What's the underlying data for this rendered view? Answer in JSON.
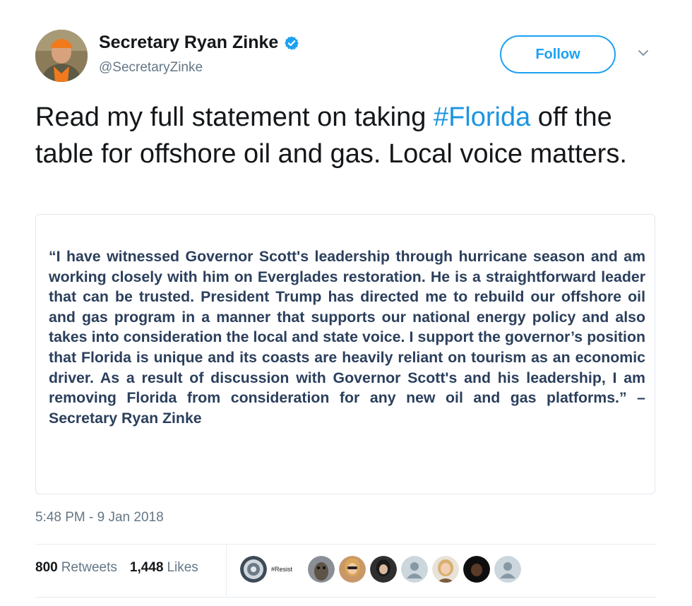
{
  "header": {
    "display_name": "Secretary Ryan Zinke",
    "handle": "@SecretaryZinke",
    "follow_label": "Follow",
    "verified_icon": "verified-badge-icon",
    "menu_icon": "chevron-down-icon"
  },
  "tweet": {
    "text_before": "Read my full statement on taking ",
    "hashtag": "#Florida",
    "text_after": " off the table for offshore oil and gas. Local voice matters."
  },
  "card": {
    "quote": "“I have witnessed Governor Scott's leadership through hurricane season and am working closely with him on Everglades restoration. He is a straightforward leader that can be trusted. President Trump has directed me to rebuild our offshore oil and gas program in a manner that supports our national energy policy and also takes into consideration the local and state voice. I support the governor’s position that Florida is unique and its coasts are heavily reliant on tourism as an economic driver.  As a result of discussion with Governor Scott's and his leadership, I am removing Florida from consideration for any new oil and gas platforms.” – Secretary Ryan Zinke"
  },
  "timestamp": "5:48 PM - 9 Jan 2018",
  "stats": {
    "retweets_count": "800",
    "retweets_label": "Retweets",
    "likes_count": "1,448",
    "likes_label": "Likes"
  },
  "likers": [
    {
      "name": "liker-avatar-1"
    },
    {
      "name": "liker-avatar-resist",
      "text": "#Resist"
    },
    {
      "name": "liker-avatar-3"
    },
    {
      "name": "liker-avatar-4"
    },
    {
      "name": "liker-avatar-5"
    },
    {
      "name": "liker-avatar-default-1"
    },
    {
      "name": "liker-avatar-6"
    },
    {
      "name": "liker-avatar-7"
    },
    {
      "name": "liker-avatar-default-2"
    }
  ],
  "colors": {
    "accent": "#1da1f2",
    "hashtag": "#1b95e0",
    "quote_text": "#2b3f5c",
    "secondary_text": "#657786"
  }
}
